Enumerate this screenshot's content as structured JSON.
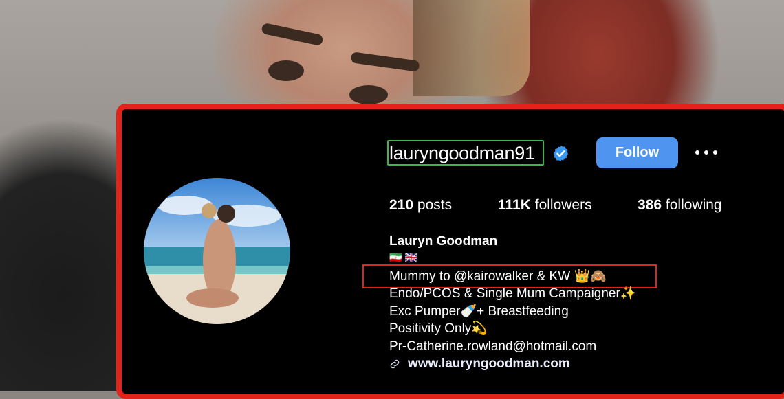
{
  "profile": {
    "username": "lauryngoodman91",
    "follow_label": "Follow",
    "stats": {
      "posts_count": "210",
      "posts_label": "posts",
      "followers_count": "111K",
      "followers_label": "followers",
      "following_count": "386",
      "following_label": "following"
    },
    "display_name": "Lauryn Goodman",
    "flags": "🇮🇷 🇬🇧",
    "bio_lines": [
      "Mummy to @kairowalker & KW 👑🙈",
      "Endo/PCOS & Single Mum Campaigner✨",
      "Exc Pumper🍼+ Breastfeeding",
      "Positivity Only💫",
      "Pr-Catherine.rowland@hotmail.com"
    ],
    "website": "www.lauryngoodman.com"
  },
  "colors": {
    "accent_red": "#e3231a",
    "follow_blue": "#4f95f0",
    "highlight_green": "#3fb84b",
    "verified_blue": "#3897f0"
  },
  "icons": [
    "verified-badge-icon",
    "more-options-icon",
    "link-icon"
  ]
}
